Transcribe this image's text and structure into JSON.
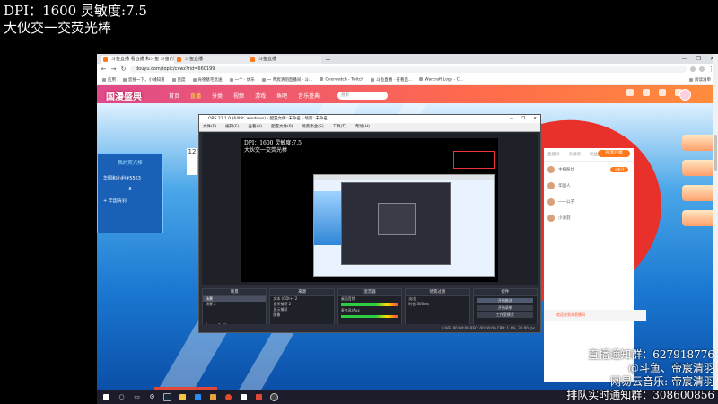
{
  "overlay": {
    "line1": "DPI：1600 灵敏度:7.5",
    "line2": "大伙交一交荧光棒",
    "bottom": [
      "直播通知群：627918776",
      "@斗鱼、帝宸清羽",
      "网易云音乐: 帝宸清羽",
      "排队实时通知群：308600856"
    ]
  },
  "browser": {
    "tabs": [
      {
        "label": "斗鱼直播 看直播 和斗鱼 斗鱼的"
      },
      {
        "label": "斗鱼直播"
      },
      {
        "label": "斗鱼直播"
      }
    ],
    "url": "douyu.com/topic/cxwz?rid=660199",
    "window_controls": [
      "—",
      "❐",
      "✕"
    ],
    "bookmarks": [
      "应用",
      "您搜一下，小绒知道",
      "百度",
      "肯德基宅急送",
      "一个 · 优乐",
      "一 帝宸清羽直播间 · 斗...",
      "Overwatch - Twitch",
      "斗鱼直播 · 在看直...",
      "Warcraft Logs - C...",
      "阅读清单"
    ]
  },
  "douyu": {
    "logo": "国漫盛典",
    "nav": [
      {
        "label": "首页",
        "active": false
      },
      {
        "label": "直播",
        "active": true
      },
      {
        "label": "分类",
        "active": false
      },
      {
        "label": "视频",
        "active": false
      },
      {
        "label": "游戏",
        "active": false
      },
      {
        "label": "鱼吧",
        "active": false
      },
      {
        "label": "音乐盛典",
        "active": false
      }
    ],
    "search_placeholder": "搜索",
    "left_card": {
      "title": "我的荧光棒",
      "row1": "华国和小利#5563",
      "row2": "8",
      "row3": "+ 华国清羽"
    },
    "video_number": "12",
    "pc_button": "PC客户端",
    "right_panel_tabs": [
      "直播间",
      "贡献榜",
      "粉丝团"
    ],
    "right_panel_rows": [
      "主播粉丝",
      "华国人",
      "一一公子",
      "小清羽"
    ],
    "follow_button": "+关注",
    "chat_welcome": "欢迎来到本直播间"
  },
  "obs": {
    "title": "OBS 21.1.0 (64bit, windows) - 配置文件: 未命名 - 场景: 未命名",
    "menu": [
      "文件(F)",
      "编辑(E)",
      "查看(V)",
      "配置文件(P)",
      "场景集合(S)",
      "工具(T)",
      "帮助(H)"
    ],
    "preview_line1": "DPI：1600 灵敏度:7.5",
    "preview_line2": "大伙交一交荧光棒",
    "docks": {
      "scenes": {
        "title": "场景",
        "items": [
          "场景",
          "场景 2"
        ]
      },
      "sources": {
        "title": "来源",
        "items": [
          "文本 (GDI+) 2",
          "显示捕获 2",
          "显示捕获",
          "图像"
        ]
      },
      "mixer": {
        "title": "混音器",
        "items": [
          "桌面音频",
          "麦克风/Aux"
        ]
      },
      "transitions": {
        "title": "场景过渡",
        "items": [
          "淡出",
          "时长 300ms"
        ]
      },
      "controls": {
        "title": "控件",
        "items": [
          "开始推流",
          "开始录制",
          "工作室模式",
          "设置",
          "退出"
        ]
      }
    },
    "status": "LIVE: 00:00:00   REC: 00:00:00   CPU: 1.4%, 30.00 fps"
  },
  "colors": {
    "douyu_orange": "#ff7a1a",
    "obs_bg": "#2b2e38",
    "taskbar": "#1c1c2a"
  },
  "taskbar_icons": [
    "windows-start-icon",
    "search-icon",
    "task-view-icon",
    "settings-icon",
    "steam-icon",
    "file-explorer-icon",
    "cortana-icon",
    "folder-icon",
    "obs-icon",
    "chrome-icon",
    "app-icon",
    "media-icon",
    "obs-icon"
  ]
}
